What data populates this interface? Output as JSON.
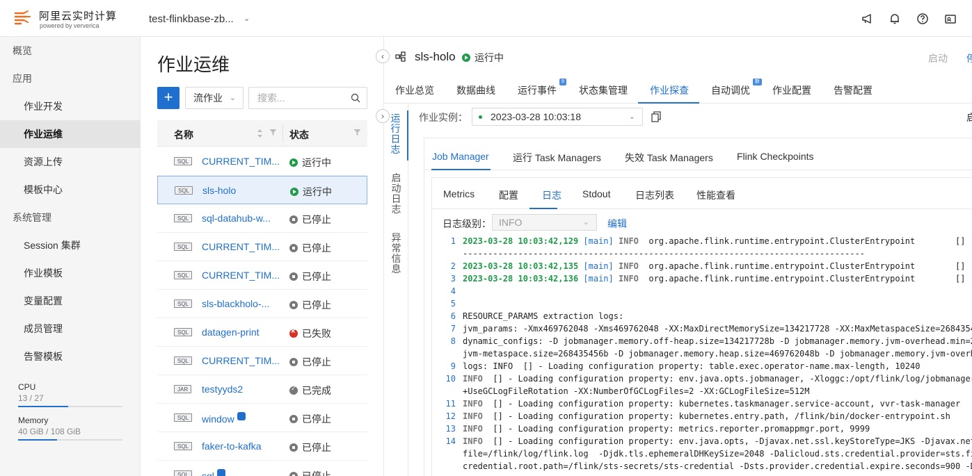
{
  "header": {
    "brand": "阿里云实时计算",
    "brand_sub": "powered by ververica",
    "workspace": "test-flinkbase-zb..."
  },
  "sidebar": {
    "items": [
      {
        "label": "概览",
        "kind": "sec"
      },
      {
        "label": "应用",
        "kind": "sec"
      },
      {
        "label": "作业开发",
        "kind": "sub"
      },
      {
        "label": "作业运维",
        "kind": "sub",
        "active": true
      },
      {
        "label": "资源上传",
        "kind": "sub"
      },
      {
        "label": "模板中心",
        "kind": "sub"
      },
      {
        "label": "系统管理",
        "kind": "sec"
      },
      {
        "label": "Session 集群",
        "kind": "sub"
      },
      {
        "label": "作业模板",
        "kind": "sub"
      },
      {
        "label": "变量配置",
        "kind": "sub"
      },
      {
        "label": "成员管理",
        "kind": "sub"
      },
      {
        "label": "告警模板",
        "kind": "sub"
      }
    ],
    "cpu": {
      "label": "CPU",
      "value": "13 / 27",
      "fraction": 0.48
    },
    "memory": {
      "label": "Memory",
      "value": "40 GiB / 108 GiB",
      "fraction": 0.37
    }
  },
  "joblist": {
    "title": "作业运维",
    "add_label": "+",
    "type_select": "流作业",
    "search_placeholder": "搜索...",
    "col_name": "名称",
    "col_status": "状态",
    "rows": [
      {
        "badge": "SQL",
        "name": "CURRENT_TIM...",
        "status": "运行中",
        "state": "run"
      },
      {
        "badge": "SQL",
        "name": "sls-holo",
        "status": "运行中",
        "state": "run",
        "selected": true
      },
      {
        "badge": "SQL",
        "name": "sql-datahub-w...",
        "status": "已停止",
        "state": "stop"
      },
      {
        "badge": "SQL",
        "name": "CURRENT_TIM...",
        "status": "已停止",
        "state": "stop"
      },
      {
        "badge": "SQL",
        "name": "CURRENT_TIM...",
        "status": "已停止",
        "state": "stop"
      },
      {
        "badge": "SQL",
        "name": "sls-blackholo-...",
        "status": "已停止",
        "state": "stop"
      },
      {
        "badge": "SQL",
        "name": "datagen-print",
        "status": "已失败",
        "state": "fail"
      },
      {
        "badge": "SQL",
        "name": "CURRENT_TIM...",
        "status": "已停止",
        "state": "stop"
      },
      {
        "badge": "JAR",
        "name": "testyyds2",
        "status": "已完成",
        "state": "done"
      },
      {
        "badge": "SQL",
        "name": "window",
        "status": "已停止",
        "state": "stop",
        "flag": true
      },
      {
        "badge": "SQL",
        "name": "faker-to-kafka",
        "status": "已停止",
        "state": "stop"
      },
      {
        "badge": "SQL",
        "name": "sql",
        "status": "已停止",
        "state": "stop",
        "flag": true
      }
    ]
  },
  "detail": {
    "job_name": "sls-holo",
    "job_state": "运行中",
    "start_label": "启动",
    "right_edge_label": "停",
    "tabs": [
      {
        "label": "作业总览"
      },
      {
        "label": "数据曲线"
      },
      {
        "label": "运行事件",
        "sup": "9"
      },
      {
        "label": "状态集管理"
      },
      {
        "label": "作业探查",
        "active": true
      },
      {
        "label": "自动调优",
        "sup": "新"
      },
      {
        "label": "作业配置"
      },
      {
        "label": "告警配置"
      }
    ],
    "vtabs": [
      "运行日志",
      "启动日志",
      "异常信息"
    ],
    "instance_label": "作业实例：",
    "instance_value": "2023-03-28 10:03:18",
    "instance_edge": "启",
    "subtabs": [
      "Job Manager",
      "运行 Task Managers",
      "失效 Task Managers",
      "Flink Checkpoints"
    ],
    "logtabs": [
      "Metrics",
      "配置",
      "日志",
      "Stdout",
      "日志列表",
      "性能查看"
    ],
    "level_label": "日志级别：",
    "level_value": "INFO",
    "edit_label": "编辑",
    "log_lines": [
      {
        "n": "1",
        "ts": "2023-03-28 10:03:42,129",
        "thr": "[main]",
        "lv": "INFO",
        "msg": "  org.apache.flink.runtime.entrypoint.ClusterEntrypoint        []"
      },
      {
        "n": "",
        "text": "--------------------------------------------------------------------------------"
      },
      {
        "n": "2",
        "ts": "2023-03-28 10:03:42,135",
        "thr": "[main]",
        "lv": "INFO",
        "msg": "  org.apache.flink.runtime.entrypoint.ClusterEntrypoint        []"
      },
      {
        "n": "3",
        "ts": "2023-03-28 10:03:42,136",
        "thr": "[main]",
        "lv": "INFO",
        "msg": "  org.apache.flink.runtime.entrypoint.ClusterEntrypoint        []"
      },
      {
        "n": "4",
        "text": ""
      },
      {
        "n": "5",
        "text": ""
      },
      {
        "n": "6",
        "text": "RESOURCE_PARAMS extraction logs:"
      },
      {
        "n": "7",
        "text": "jvm_params: -Xmx469762048 -Xms469762048 -XX:MaxDirectMemorySize=134217728 -XX:MaxMetaspaceSize=268435456"
      },
      {
        "n": "8",
        "text": "dynamic_configs: -D jobmanager.memory.off-heap.size=134217728b -D jobmanager.memory.jvm-overhead.min=201326592b"
      },
      {
        "n": "",
        "text": "jvm-metaspace.size=268435456b -D jobmanager.memory.heap.size=469762048b -D jobmanager.memory.jvm-overhead.max"
      },
      {
        "n": "9",
        "text": "logs: INFO  [] - Loading configuration property: table.exec.operator-name.max-length, 10240"
      },
      {
        "n": "10",
        "lv": "INFO",
        "msg": "  [] - Loading configuration property: env.java.opts.jobmanager, -Xloggc:/opt/flink/log/jobmanager-gc.log"
      },
      {
        "n": "",
        "text": "+UseGCLogFileRotation -XX:NumberOfGCLogFiles=2 -XX:GCLogFileSize=512M"
      },
      {
        "n": "11",
        "lv": "INFO",
        "msg": "  [] - Loading configuration property: kubernetes.taskmanager.service-account, vvr-task-manager"
      },
      {
        "n": "12",
        "lv": "INFO",
        "msg": "  [] - Loading configuration property: kubernetes.entry.path, /flink/bin/docker-entrypoint.sh"
      },
      {
        "n": "13",
        "lv": "INFO",
        "msg": "  [] - Loading configuration property: metrics.reporter.promappmgr.port, 9999"
      },
      {
        "n": "14",
        "lv": "INFO",
        "msg": "  [] - Loading configuration property: env.java.opts, -Djavax.net.ssl.keyStoreType=JKS -Djavax.net.ssl"
      },
      {
        "n": "",
        "text": "file=/flink/log/flink.log  -Djdk.tls.ephemeralDHKeySize=2048 -Dalicloud.sts.credential.provider=sts.file"
      },
      {
        "n": "",
        "text": "credential.root.path=/flink/sts-secrets/sts-credential -Dsts.provider.credential.expire.seconds=900 -Dsts.prov"
      }
    ]
  }
}
